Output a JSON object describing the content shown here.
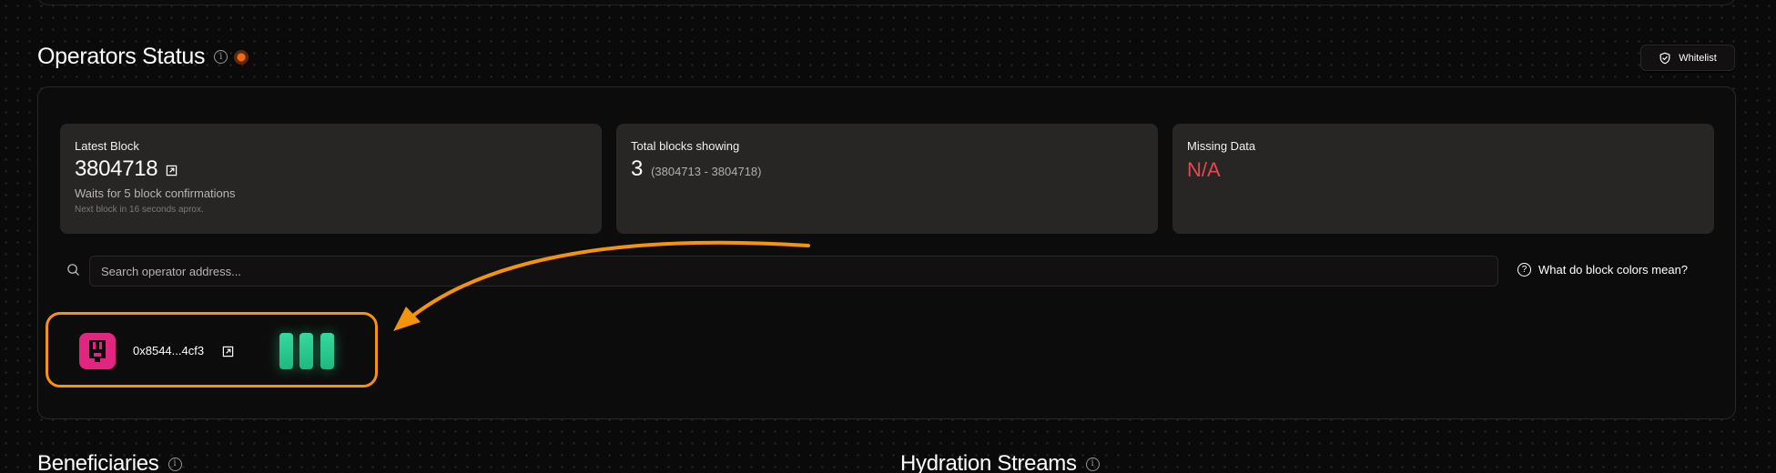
{
  "operators_status": {
    "title": "Operators Status",
    "whitelist_label": "Whitelist"
  },
  "cards": {
    "latest_block": {
      "label": "Latest Block",
      "value": "3804718",
      "subtitle": "Waits for 5 block confirmations",
      "hint": "Next block in 16 seconds aprox."
    },
    "total_blocks": {
      "label": "Total blocks showing",
      "value": "3",
      "range": "(3804713 - 3804718)"
    },
    "missing_data": {
      "label": "Missing Data",
      "value": "N/A"
    }
  },
  "search": {
    "placeholder": "Search operator address...",
    "value": ""
  },
  "help": {
    "label": "What do block colors mean?"
  },
  "operator": {
    "address": "0x8544...4cf3",
    "blocks": [
      "ok",
      "ok",
      "ok"
    ]
  },
  "bottom_sections": {
    "beneficiaries": "Beneficiaries",
    "hydration_streams": "Hydration Streams"
  },
  "colors": {
    "accent_orange": "#f3940f",
    "status_dot": "#f36a12",
    "block_ok": "#2ecc95",
    "missing": "#e5484d",
    "avatar": "#e2257f"
  },
  "icons": [
    "info-icon",
    "status-dot-icon",
    "shield-check-icon",
    "external-link-icon",
    "search-icon",
    "question-circle-icon",
    "avatar-icon",
    "annotation-arrow-icon"
  ]
}
